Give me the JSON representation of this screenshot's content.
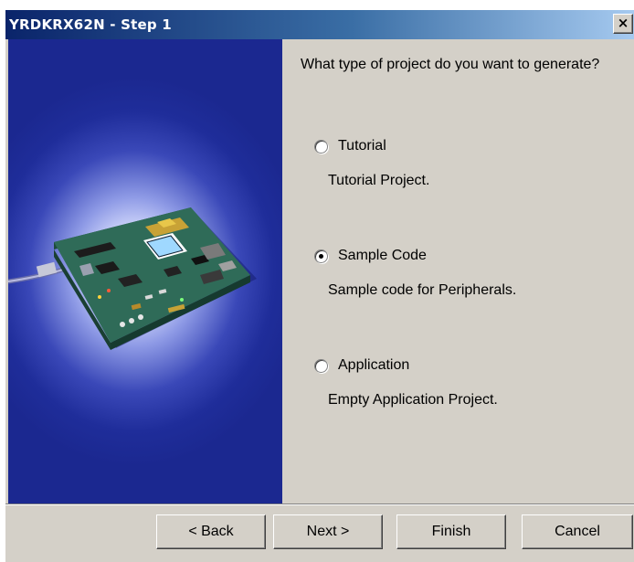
{
  "window": {
    "title": "YRDKRX62N - Step 1",
    "close_glyph": "×"
  },
  "prompt": {
    "question": "What type of project do you want to generate?"
  },
  "options": [
    {
      "label": "Tutorial",
      "description": "Tutorial Project.",
      "checked": false
    },
    {
      "label": "Sample Code",
      "description": "Sample code for Peripherals.",
      "checked": true
    },
    {
      "label": "Application",
      "description": "Empty Application Project.",
      "checked": false
    }
  ],
  "buttons": {
    "back": "< Back",
    "next": "Next >",
    "finish": "Finish",
    "cancel": "Cancel"
  },
  "colors": {
    "titlebar_start": "#0a246a",
    "titlebar_end": "#a6caf0",
    "dialog_face": "#d4d0c8",
    "banner_blue": "#1f2d9a",
    "board_green": "#2f6b58"
  }
}
